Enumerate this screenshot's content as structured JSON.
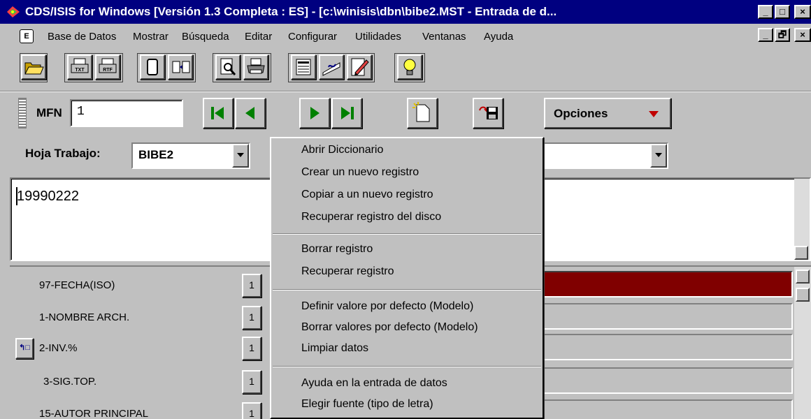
{
  "window": {
    "title": "CDS/ISIS for Windows [Versión 1.3 Completa : ES] - [c:\\winisis\\dbn\\bibe2.MST - Entrada de d...",
    "min_label": "_",
    "max_label": "□",
    "close_label": "×",
    "restore_label": "🗗"
  },
  "menubar": {
    "items": [
      "Base de Datos",
      "Mostrar",
      "Búsqueda",
      "Editar",
      "Configurar",
      "Utilidades",
      "Ventanas",
      "Ayuda"
    ],
    "doc_icon_label": "E"
  },
  "toolbar": {
    "buttons": [
      "open-folder",
      "print-txt",
      "print-rtf",
      "copy-record",
      "export",
      "preview",
      "print",
      "form",
      "edit-sign",
      "pencil",
      "lightbulb"
    ],
    "txt_label": "TXT",
    "rtf_label": "RTF"
  },
  "navbar": {
    "mfn_label": "MFN",
    "mfn_value": "1",
    "opciones_label": "Opciones"
  },
  "worksheet": {
    "label": "Hoja Trabajo:",
    "value": "BIBE2"
  },
  "editor": {
    "text": "19990222"
  },
  "fields": [
    {
      "label": "97-FECHA(ISO)",
      "rep": "1"
    },
    {
      "label": "1-NOMBRE ARCH.",
      "rep": "1"
    },
    {
      "label": "2-INV.%",
      "rep": "1"
    },
    {
      "label": "3-SIG.TOP.",
      "rep": "1"
    },
    {
      "label": "15-AUTOR PRINCIPAL",
      "rep": "1"
    }
  ],
  "context_menu": {
    "items": [
      "Abrir Diccionario",
      "Crear un nuevo registro",
      "Copiar a un nuevo registro",
      "Recuperar registro del disco",
      "Borrar registro",
      "Recuperar registro",
      "Definir valore por defecto (Modelo)",
      "Borrar valores por defecto (Modelo)",
      "Limpiar datos",
      "Ayuda en la entrada de datos",
      "Elegir fuente (tipo de letra)"
    ]
  },
  "colors": {
    "titlebar": "#000080",
    "active_field": "#800000",
    "window_bg": "#c0c0c0"
  }
}
